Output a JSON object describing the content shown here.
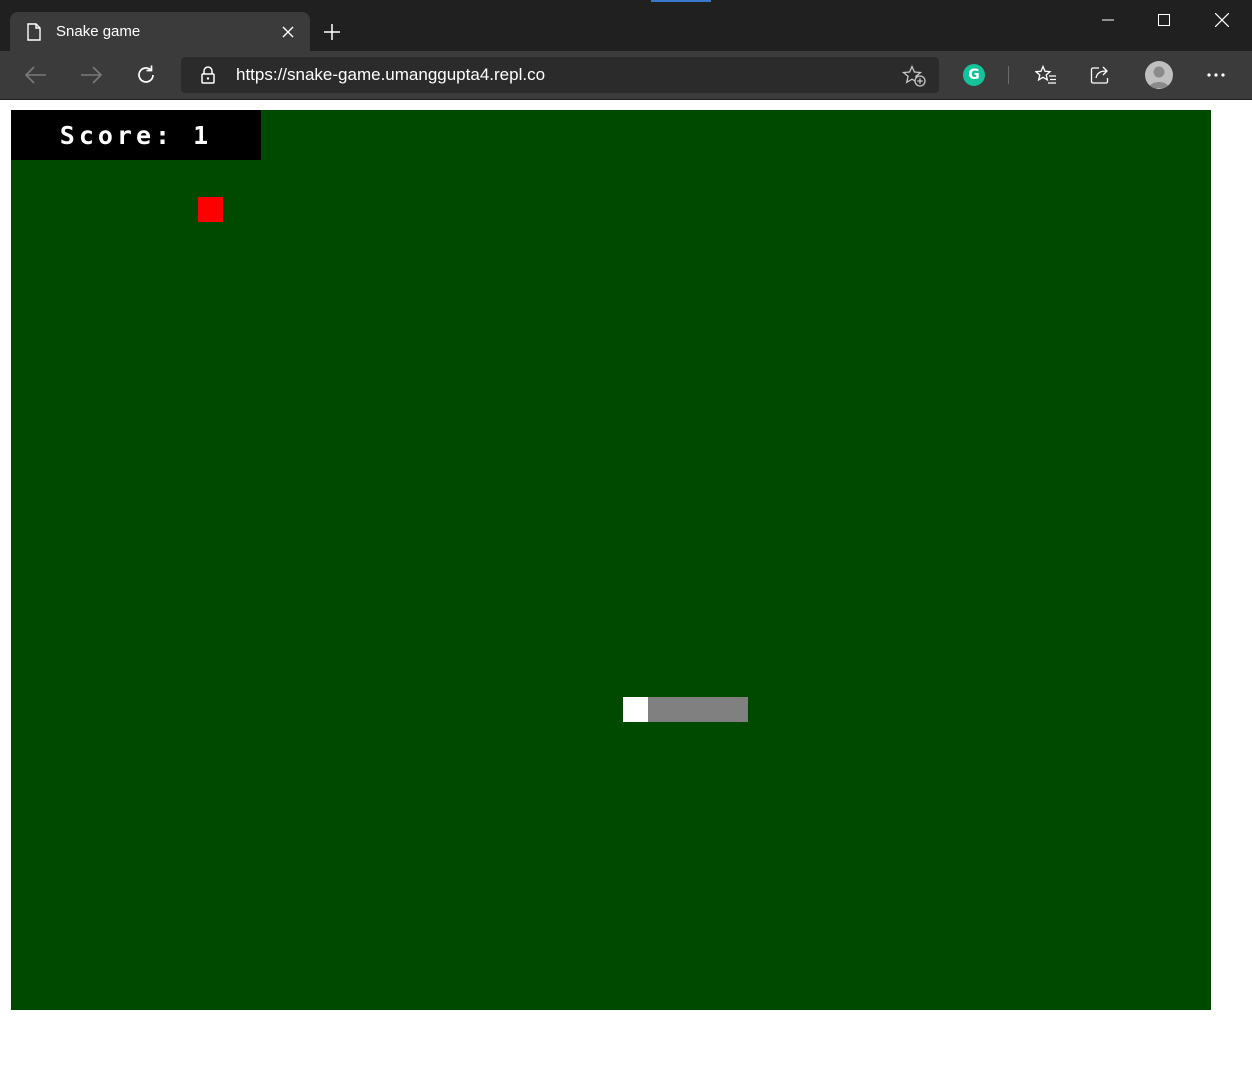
{
  "browser": {
    "tab_title": "Snake game",
    "url": "https://snake-game.umanggupta4.repl.co",
    "accent_color": "#3a78c9"
  },
  "icons": {
    "tab": "page-icon",
    "close_tab": "close-icon",
    "new_tab": "plus-icon",
    "minimize": "minimize-icon",
    "maximize": "maximize-icon",
    "close_window": "close-icon",
    "back": "back-arrow-icon",
    "forward": "forward-arrow-icon",
    "refresh": "refresh-icon",
    "site_info": "lock-icon",
    "add_favorite": "star-plus-icon",
    "grammarly": "grammarly-icon",
    "favorites": "favorites-icon",
    "share": "share-icon",
    "profile": "avatar",
    "more": "more-icon"
  },
  "grammarly_glyph": "G",
  "game": {
    "score_label": "Score:",
    "score_value": "1",
    "background_color": "#004a00",
    "food_color": "#ff0000",
    "snake_head_color": "#ffffff",
    "snake_body_color": "#808080"
  }
}
